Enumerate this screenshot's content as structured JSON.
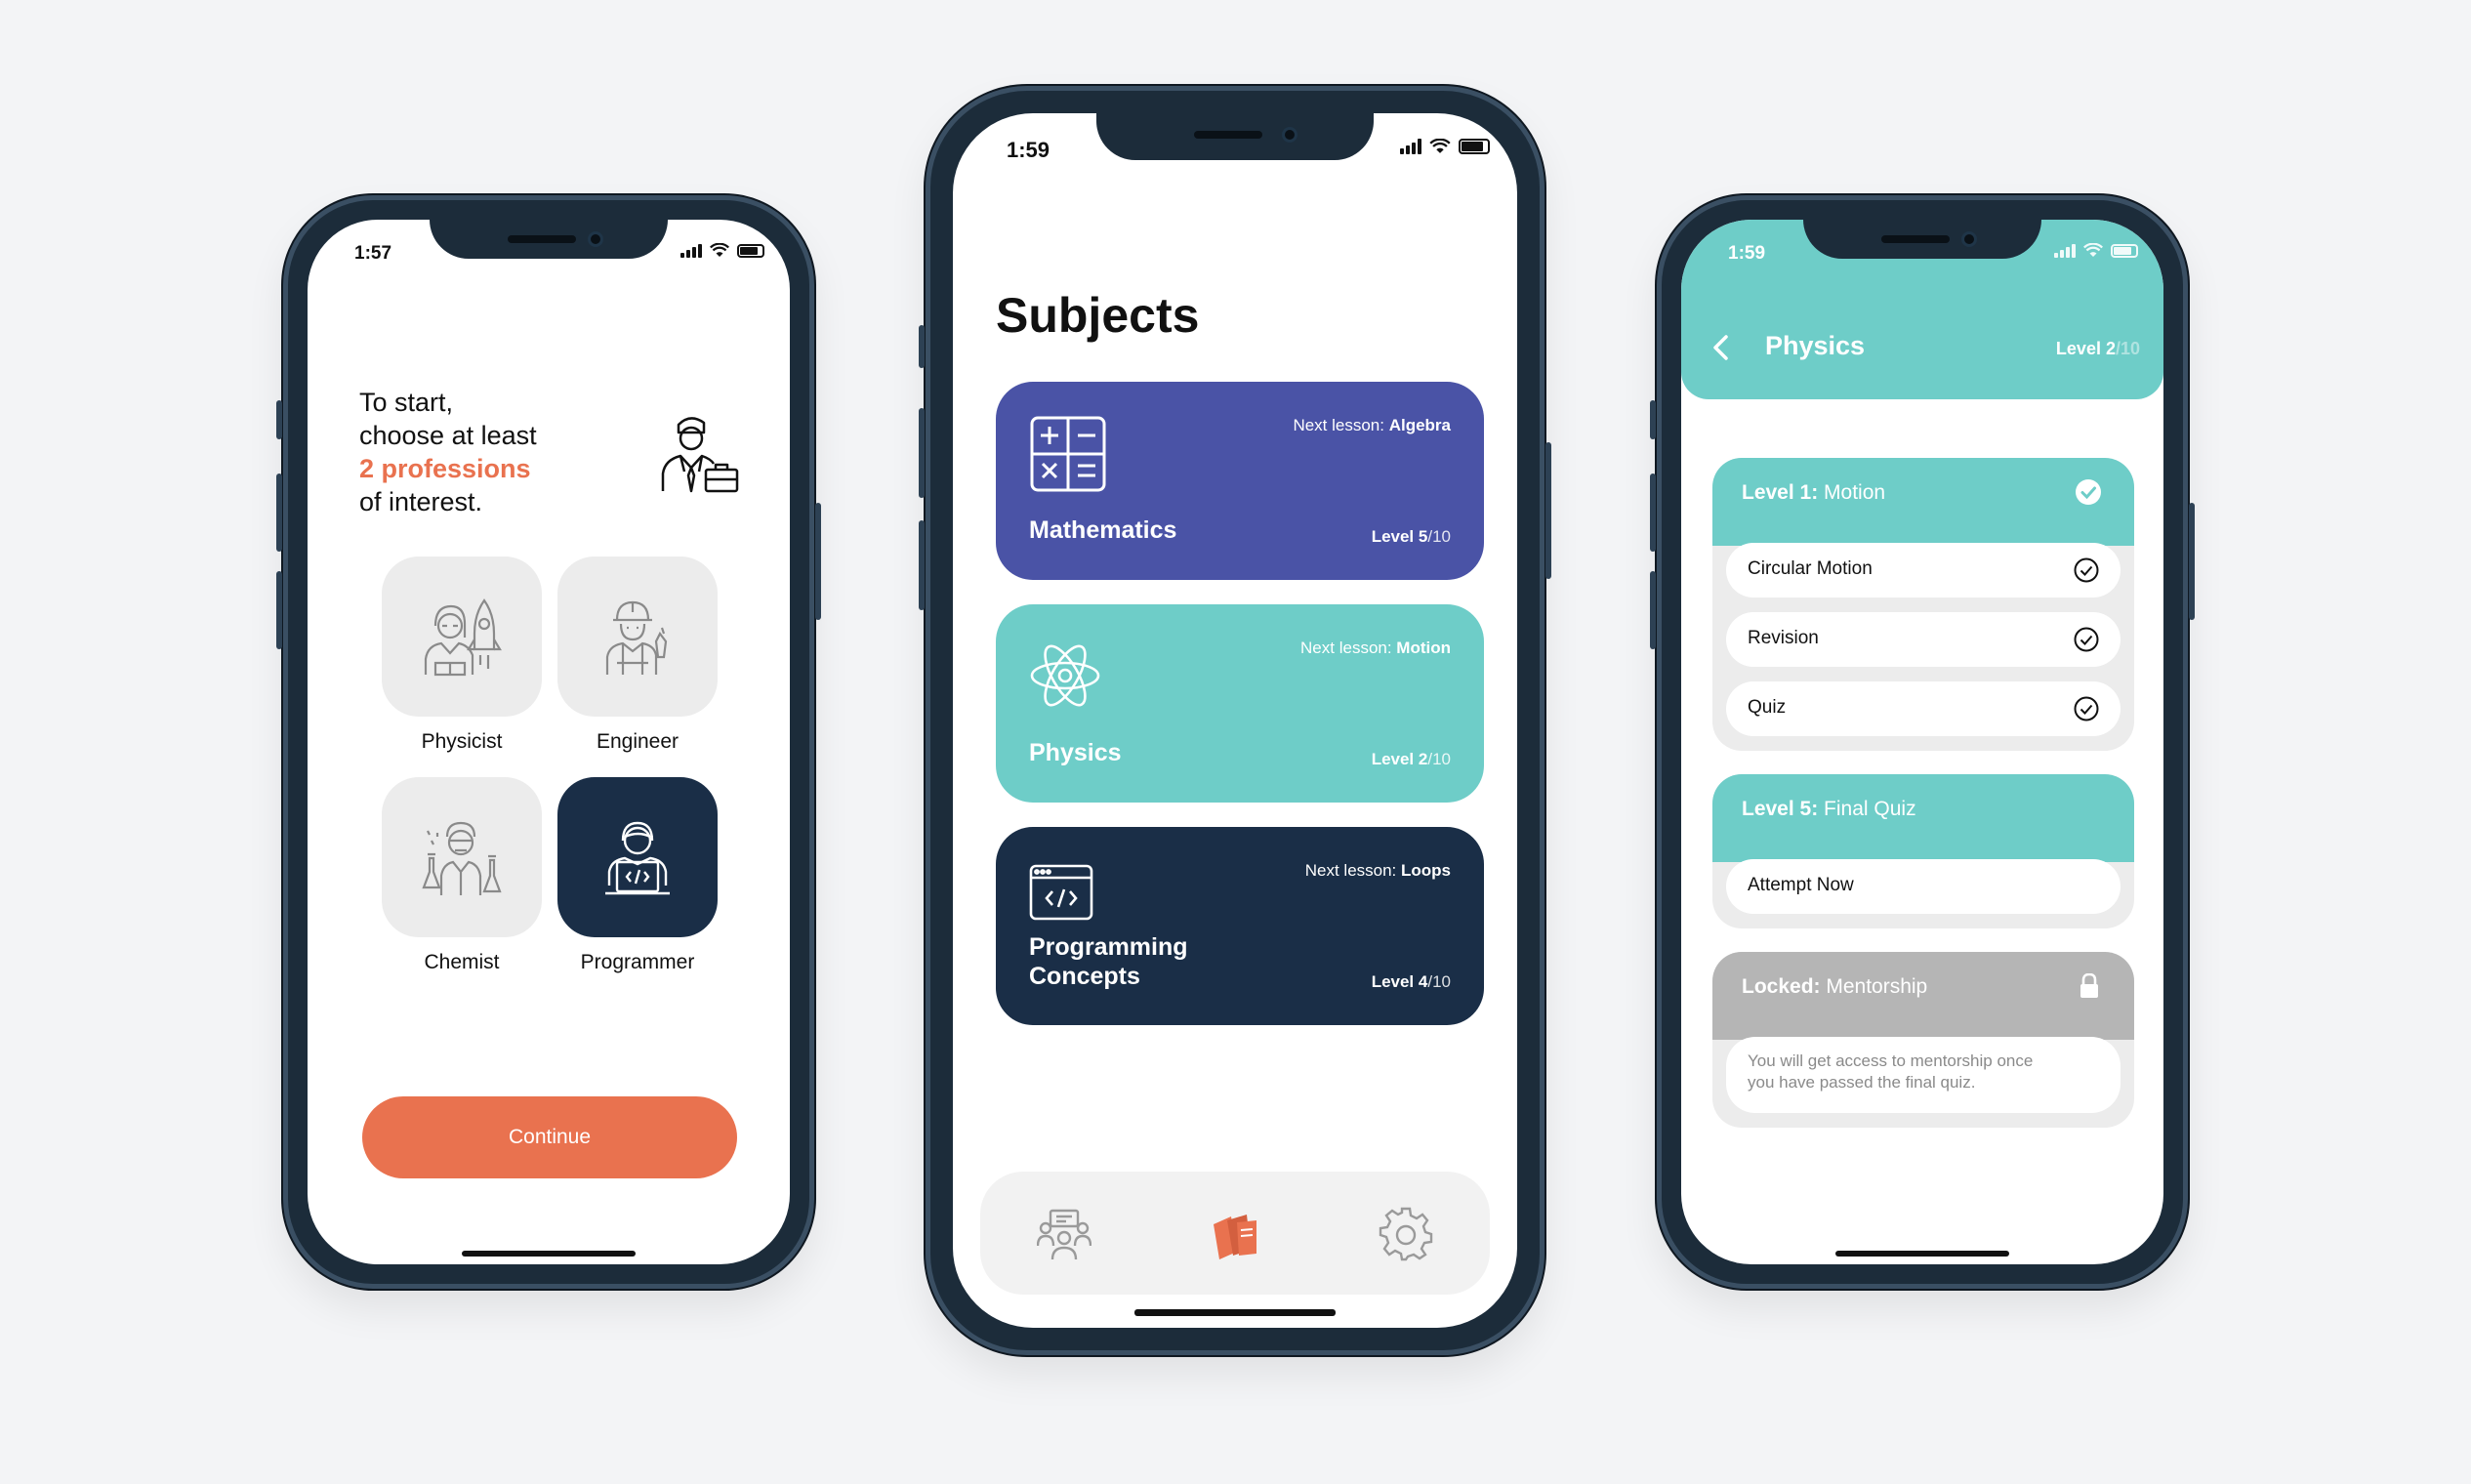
{
  "phone1": {
    "time": "1:57",
    "intro_line1": "To start,",
    "intro_line2": "choose at least",
    "intro_highlight": "2 professions",
    "intro_line4": "of interest.",
    "professions": [
      {
        "label": "Physicist",
        "icon": "physicist-icon",
        "selected": false
      },
      {
        "label": "Engineer",
        "icon": "engineer-icon",
        "selected": false
      },
      {
        "label": "Chemist",
        "icon": "chemist-icon",
        "selected": false
      },
      {
        "label": "Programmer",
        "icon": "programmer-icon",
        "selected": true
      }
    ],
    "continue_label": "Continue"
  },
  "phone2": {
    "time": "1:59",
    "title": "Subjects",
    "subjects": [
      {
        "name_line1": "Mathematics",
        "name_line2": "",
        "next_prefix": "Next lesson: ",
        "next_lesson": "Algebra",
        "level_prefix": "Level ",
        "level": "5",
        "level_total": "/10",
        "color": "#4a53a6",
        "icon": "calculator-icon"
      },
      {
        "name_line1": "Physics",
        "name_line2": "",
        "next_prefix": "Next lesson: ",
        "next_lesson": "Motion",
        "level_prefix": "Level ",
        "level": "2",
        "level_total": "/10",
        "color": "#6ecdc8",
        "icon": "atom-icon"
      },
      {
        "name_line1": "Programming",
        "name_line2": "Concepts",
        "next_prefix": "Next lesson: ",
        "next_lesson": "Loops",
        "level_prefix": "Level ",
        "level": "4",
        "level_total": "/10",
        "color": "#1a2e47",
        "icon": "code-window-icon"
      }
    ],
    "tabs": [
      {
        "icon": "mentors-icon",
        "active": false
      },
      {
        "icon": "books-icon",
        "active": true
      },
      {
        "icon": "settings-gear-icon",
        "active": false
      }
    ]
  },
  "phone3": {
    "time": "1:59",
    "title": "Physics",
    "level_label": "Level 2",
    "level_total": "/10",
    "sections": [
      {
        "title_bold": "Level 1:",
        "title_rest": " Motion",
        "items": [
          "Circular Motion",
          "Revision",
          "Quiz"
        ]
      },
      {
        "title_bold": "Level 5:",
        "title_rest": " Final Quiz",
        "items": [
          "Attempt Now"
        ]
      }
    ],
    "locked": {
      "title_bold": "Locked:",
      "title_rest": " Mentorship",
      "message_line1": "You will get access to mentorship once",
      "message_line2": "you have passed the final quiz."
    }
  },
  "colors": {
    "accent": "#e9724f",
    "teal": "#6ecdc8",
    "navy": "#1a2e47",
    "indigo": "#4a53a6",
    "locked": "#b5b5b5"
  }
}
